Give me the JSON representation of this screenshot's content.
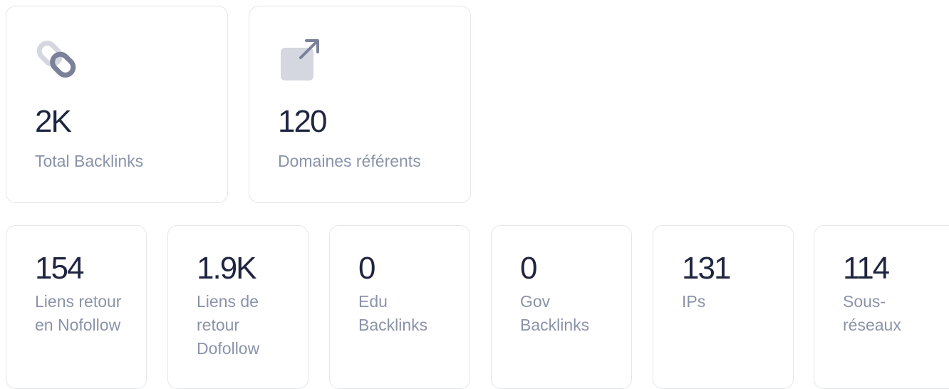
{
  "colors": {
    "value_text": "#1f2540",
    "label_text": "#8a93a8",
    "icon": "#7a8199",
    "icon_light": "#d4d7e0",
    "card_border": "#e4e6eb"
  },
  "top_cards": [
    {
      "icon": "link-icon",
      "value": "2K",
      "label": "Total Backlinks"
    },
    {
      "icon": "external-link-icon",
      "value": "120",
      "label": "Domaines référents"
    }
  ],
  "bottom_cards": [
    {
      "value": "154",
      "label": "Liens retour en Nofollow"
    },
    {
      "value": "1.9K",
      "label": "Liens de retour Dofollow"
    },
    {
      "value": "0",
      "label": "Edu Backlinks"
    },
    {
      "value": "0",
      "label": "Gov Backlinks"
    },
    {
      "value": "131",
      "label": "IPs"
    },
    {
      "value": "114",
      "label": "Sous-réseaux"
    }
  ]
}
